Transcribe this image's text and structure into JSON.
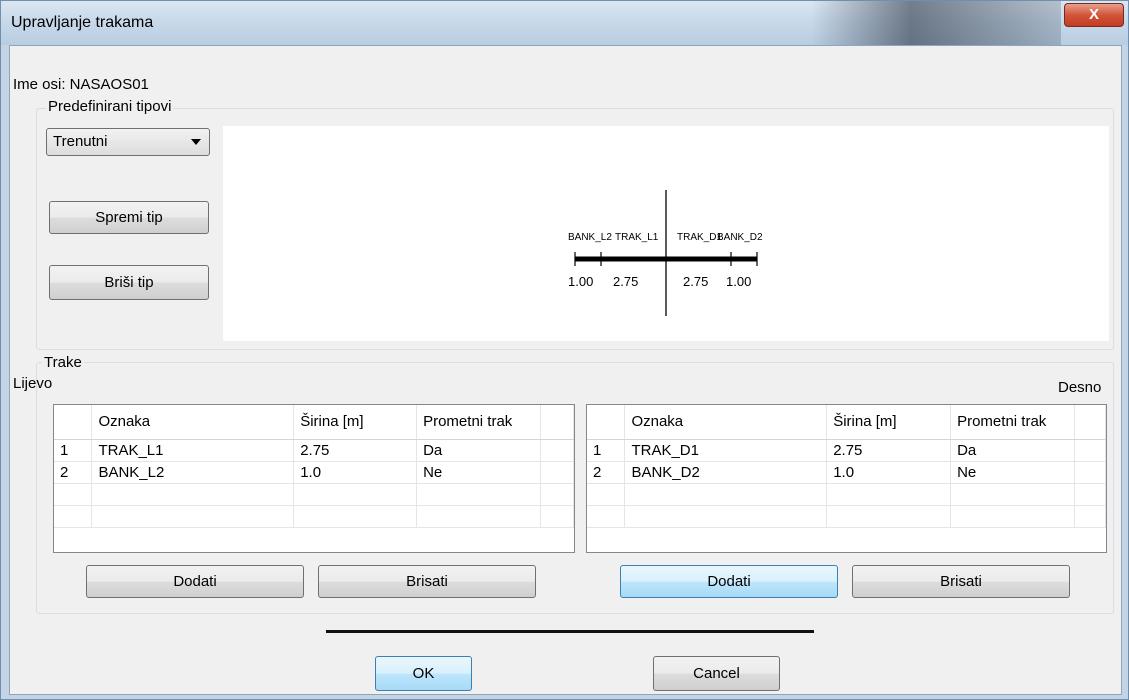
{
  "window": {
    "title": "Upravljanje trakama",
    "close_glyph": "X"
  },
  "axis_name": "Ime osi: NASAOS01",
  "predefined": {
    "group_label": "Predefinirani tipovi",
    "type_select_value": "Trenutni",
    "save_type_label": "Spremi tip",
    "delete_type_label": "Briši tip"
  },
  "preview": {
    "lane_labels": [
      "BANK_L2",
      "TRAK_L1",
      "TRAK_D1",
      "BANK_D2"
    ],
    "width_labels": [
      "1.00",
      "2.75",
      "2.75",
      "1.00"
    ]
  },
  "lanes": {
    "group_label": "Trake",
    "left_label": "Lijevo",
    "right_label": "Desno",
    "columns": [
      "Oznaka",
      "Širina [m]",
      "Prometni trak"
    ],
    "left_rows": [
      {
        "num": "1",
        "oznaka": "TRAK_L1",
        "sirina": "2.75",
        "prometni": "Da"
      },
      {
        "num": "2",
        "oznaka": "BANK_L2",
        "sirina": "1.0",
        "prometni": "Ne"
      }
    ],
    "right_rows": [
      {
        "num": "1",
        "oznaka": "TRAK_D1",
        "sirina": "2.75",
        "prometni": "Da"
      },
      {
        "num": "2",
        "oznaka": "BANK_D2",
        "sirina": "1.0",
        "prometni": "Ne"
      }
    ],
    "add_label": "Dodati",
    "delete_label": "Brisati"
  },
  "footer": {
    "ok_label": "OK",
    "cancel_label": "Cancel"
  },
  "colors": {
    "title_gradient_top": "#dbe7f2",
    "close_button": "#c23c21",
    "focused_button_border": "#3c7fb1"
  }
}
